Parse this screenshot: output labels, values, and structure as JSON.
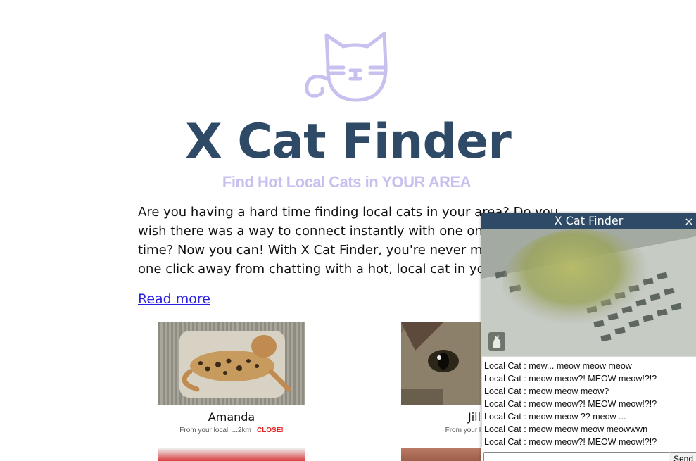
{
  "app": {
    "title": "X Cat Finder",
    "subtitle": "Find Hot Local Cats in YOUR AREA",
    "intro": "Are you having a hard time finding local cats in your area? Do you wish there was a way to connect instantly with one online at any time? Now you can! With X Cat Finder, you're never more than one click away from chatting with a hot, local cat in your area!",
    "read_more": "Read more"
  },
  "cards": [
    {
      "name": "Amanda",
      "distance": "From your local: ...2km",
      "badge": "CLOSE!"
    },
    {
      "name": "Jill",
      "distance": "From your local: ...",
      "badge": ""
    }
  ],
  "chat": {
    "title": "X Cat Finder",
    "close_label": "×",
    "messages": [
      "Local Cat : mew... meow meow meow",
      "Local Cat : meow meow?! MEOW meow!?!?",
      "Local Cat : meow meow meow?",
      "Local Cat : meow meow?! MEOW meow!?!?",
      "Local Cat : meow meow ?? meow ...",
      "Local Cat : meow meow meow meowwwn",
      "Local Cat : meow meow?! MEOW meow!?!?"
    ],
    "input_value": "",
    "send_label": "Send"
  },
  "colors": {
    "title": "#2f4a66",
    "subtitle": "#c9c0ef",
    "logo": "#c9c0ef",
    "link": "#2a1ee0",
    "badge": "#e52020",
    "chat_header": "#2f4a66"
  },
  "icons": {
    "logo": "cat-face-logo-icon",
    "chat_close": "close-icon",
    "video_overlay": "cat-silhouette-icon"
  }
}
